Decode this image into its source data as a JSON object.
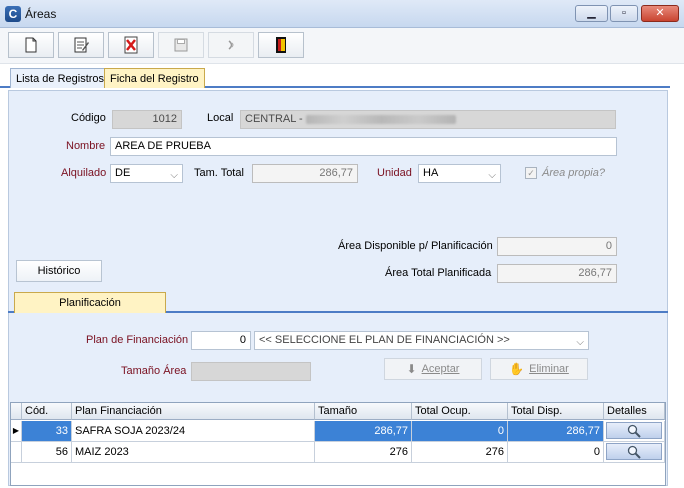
{
  "window": {
    "title": "Áreas",
    "icon": "app-icon"
  },
  "toolbar": {
    "buttons": [
      {
        "name": "new-document-icon",
        "label": ""
      },
      {
        "name": "edit-document-icon",
        "label": ""
      },
      {
        "name": "delete-icon",
        "label": ""
      },
      {
        "name": "save-icon",
        "label": ""
      },
      {
        "name": "undo-icon",
        "label": ""
      },
      {
        "name": "exit-icon",
        "label": ""
      }
    ]
  },
  "tabs": [
    {
      "label": "Lista de Registros"
    },
    {
      "label": "Ficha del Registro"
    }
  ],
  "form": {
    "codigo_label": "Código",
    "codigo_value": "1012",
    "local_label": "Local",
    "local_value": "CENTRAL -",
    "nombre_label": "Nombre",
    "nombre_value": "AREA DE PRUEBA",
    "alquilado_label": "Alquilado",
    "alquilado_value": "DE",
    "tam_total_label": "Tam. Total",
    "tam_total_value": "286,77",
    "unidad_label": "Unidad",
    "unidad_value": "HA",
    "area_propia_label": "Área propia?",
    "area_disp_label": "Área Disponible p/ Planificación",
    "area_disp_value": "0",
    "area_total_label": "Área Total Planificada",
    "area_total_value": "286,77",
    "historico_button": "Histórico"
  },
  "planificacion": {
    "tab_label": "Planificación",
    "plan_label": "Plan de Financiación",
    "plan_code": "0",
    "plan_placeholder": "<< SELECCIONE EL PLAN DE FINANCIACIÓN >>",
    "tamano_label": "Tamaño Área",
    "tamano_value": "",
    "aceptar_button": "Aceptar",
    "eliminar_button": "Eliminar"
  },
  "grid": {
    "columns": [
      "Cód.",
      "Plan Financiación",
      "Tamaño",
      "Total Ocup.",
      "Total Disp.",
      "Detalles"
    ],
    "rows": [
      {
        "cod": "33",
        "plan": "SAFRA SOJA 2023/24",
        "tamano": "286,77",
        "ocup": "0",
        "disp": "286,77"
      },
      {
        "cod": "56",
        "plan": "MAIZ 2023",
        "tamano": "276",
        "ocup": "276",
        "disp": "0"
      }
    ]
  },
  "colors": {
    "accent": "#4d7cc5",
    "selected_row": "#3c82d6",
    "label_red": "#7a1020",
    "active_tab": "#fff3c4"
  }
}
